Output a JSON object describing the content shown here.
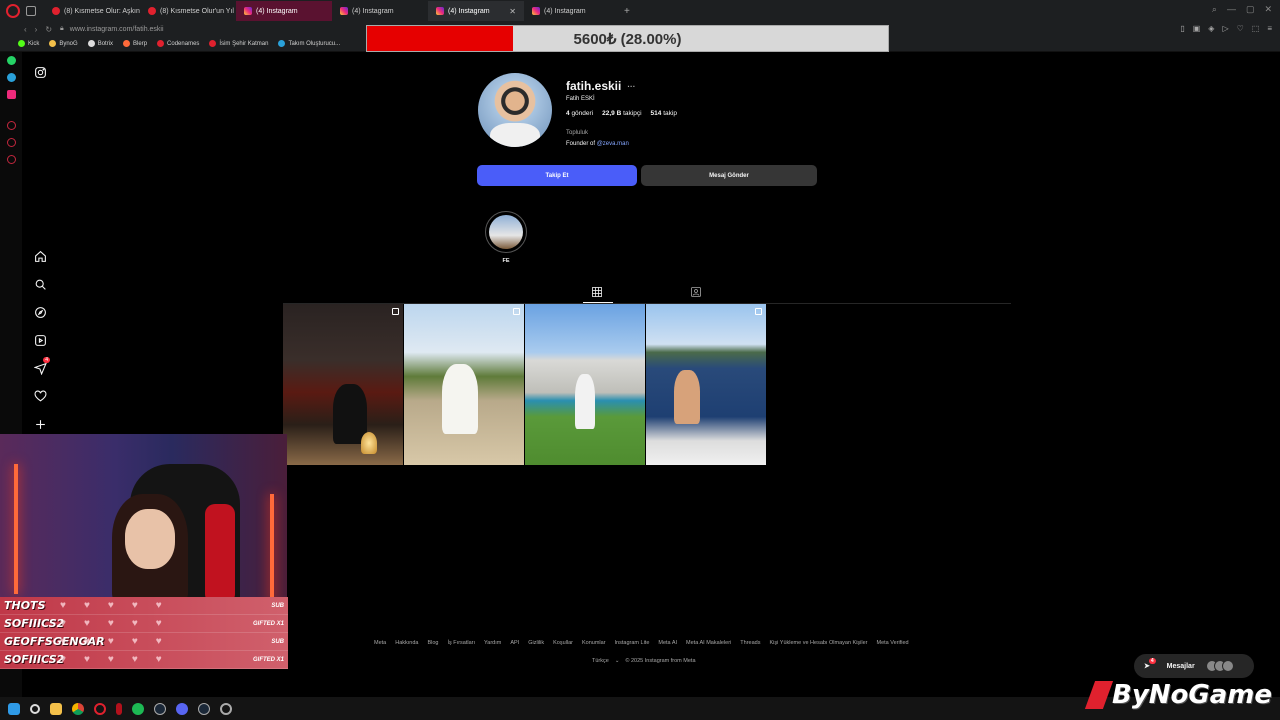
{
  "browser": {
    "tabs": [
      {
        "label": "(8) Kısmetse Olur: Aşkın",
        "icon": "youtube-icon"
      },
      {
        "label": "(8) Kısmetse Olur'un Yıl",
        "icon": "youtube-icon"
      },
      {
        "label": "(4) Instagram",
        "icon": "instagram-icon"
      },
      {
        "label": "(4) Instagram",
        "icon": "instagram-icon"
      },
      {
        "label": "(4) Instagram",
        "icon": "instagram-icon"
      },
      {
        "label": "(4) Instagram",
        "icon": "instagram-icon"
      }
    ],
    "url": "www.instagram.com/fatih.eskii",
    "bookmarks": [
      "Kick",
      "BynoG",
      "Botrix",
      "Blerp",
      "Codenames",
      "İsim Şehir Katman",
      "Takım Oluşturucu..."
    ]
  },
  "donation": {
    "text": "5600₺ (28.00%)",
    "progress": 0.28,
    "fill_color": "#e60000"
  },
  "ig_nav": [
    "instagram-icon",
    "home-icon",
    "search-icon",
    "explore-icon",
    "reels-icon",
    "messages-icon",
    "heart-icon",
    "create-icon"
  ],
  "ig_nav_badge": "4",
  "profile": {
    "username": "fatih.eskii",
    "more": "···",
    "full_name": "Fatih ESKİ",
    "posts_count": "4",
    "posts_label": "gönderi",
    "followers_count": "22,9 B",
    "followers_label": "takipçi",
    "following_count": "514",
    "following_label": "takip",
    "category": "Topluluk",
    "bio_prefix": "Founder of",
    "bio_link": "@zeva.man",
    "follow_button": "Takip Et",
    "message_button": "Mesaj Gönder",
    "highlight_label": "FE",
    "follow_color": "#4a5df9"
  },
  "footer": {
    "links": [
      "Meta",
      "Hakkında",
      "Blog",
      "İş Fırsatları",
      "Yardım",
      "API",
      "Gizlilik",
      "Koşullar",
      "Konumlar",
      "Instagram Lite",
      "Meta AI",
      "Meta AI Makaleleri",
      "Threads",
      "Kişi Yükleme ve Hesabı Olmayan Kişiler",
      "Meta Verified"
    ],
    "language": "Türkçe",
    "copyright": "© 2025 Instagram from Meta"
  },
  "messages_pill": {
    "label": "Mesajlar",
    "badge": "4"
  },
  "subs": [
    {
      "name": "THOTS",
      "tag": "SUB"
    },
    {
      "name": "SOFIIICS2",
      "tag": "GIFTED X1"
    },
    {
      "name": "GEOFFSGENGAR",
      "tag": "SUB"
    },
    {
      "name": "SOFIIICS2",
      "tag": "GIFTED X1"
    }
  ],
  "watermark": "ByNoGame"
}
